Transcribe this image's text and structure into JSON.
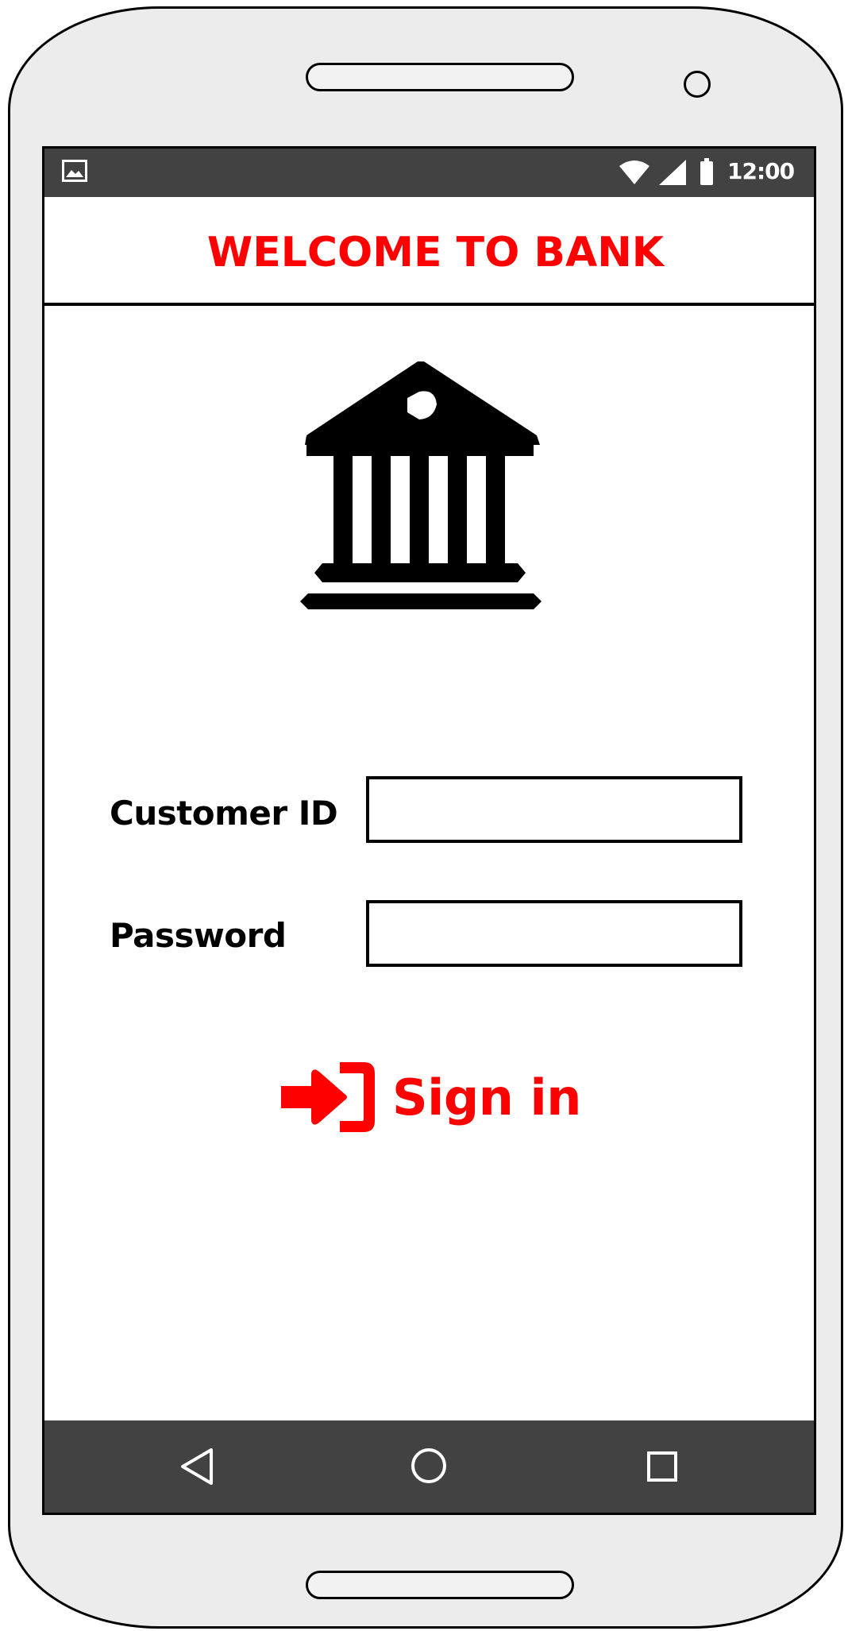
{
  "status_bar": {
    "time": "12:00",
    "icons": [
      "gallery-icon",
      "wifi-icon",
      "signal-icon",
      "battery-icon"
    ]
  },
  "header": {
    "title": "WELCOME TO BANK",
    "title_color": "#ff0000"
  },
  "logo": {
    "icon": "bank-building-icon"
  },
  "form": {
    "customer_id_label": "Customer ID",
    "customer_id_value": "",
    "password_label": "Password",
    "password_value": ""
  },
  "sign_in": {
    "label": "Sign in",
    "icon": "sign-in-arrow-icon",
    "color": "#ff0000"
  },
  "nav_bar": {
    "icons": [
      "back-icon",
      "home-icon",
      "recent-apps-icon"
    ]
  },
  "colors": {
    "accent": "#ff0000",
    "bar_background": "#424242",
    "device_body": "#ececec"
  }
}
